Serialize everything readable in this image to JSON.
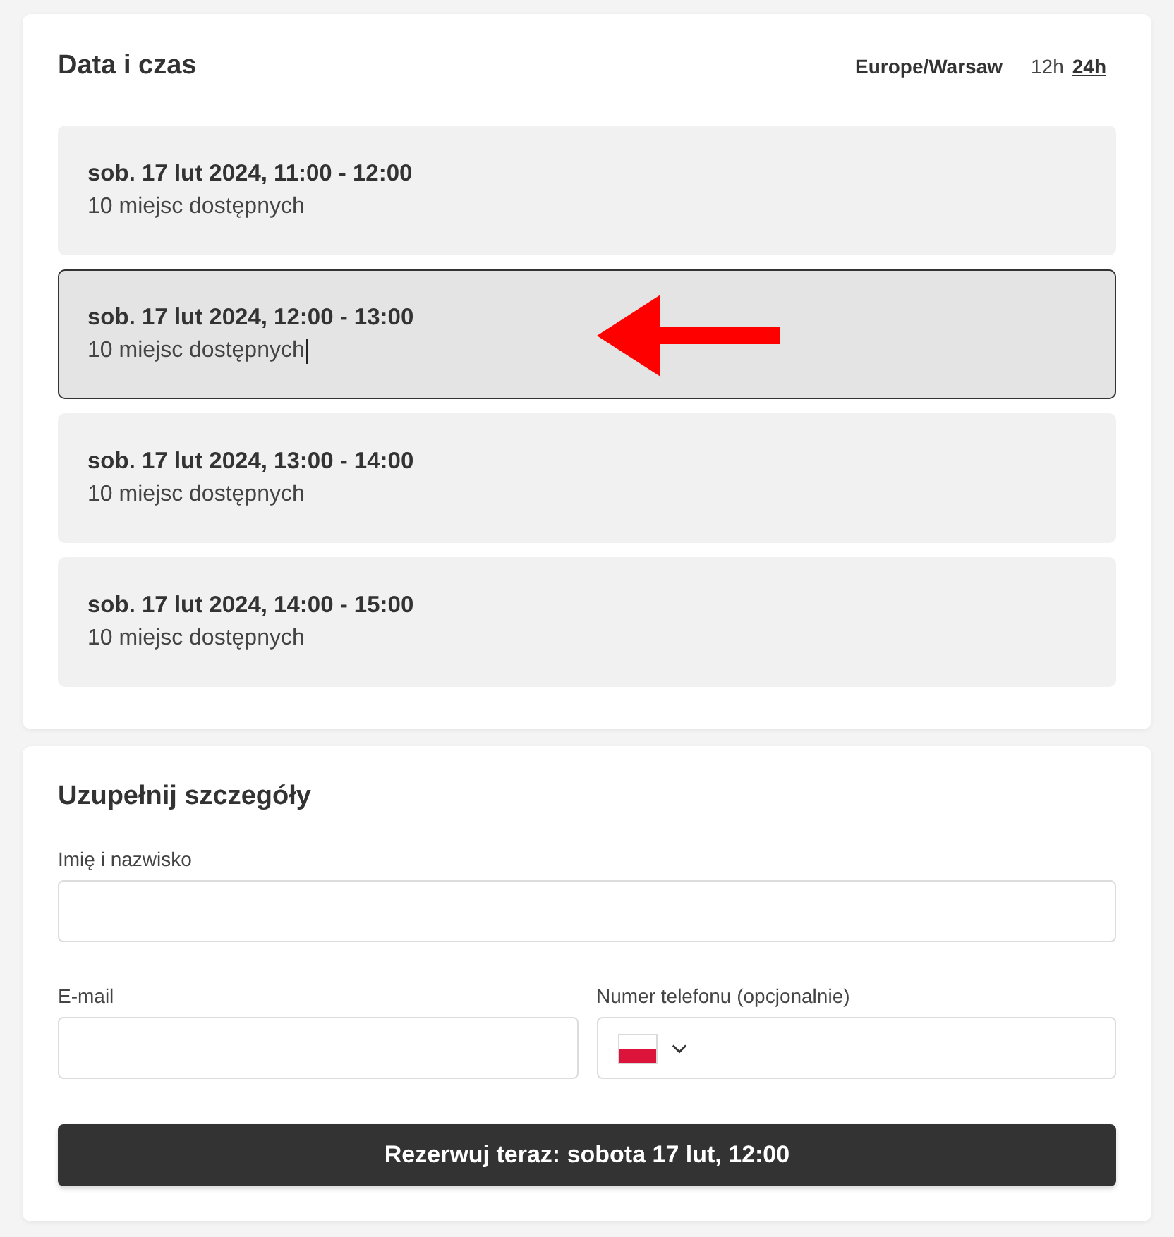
{
  "date_time": {
    "title": "Data i czas",
    "timezone": "Europe/Warsaw",
    "formats": [
      {
        "label": "12h",
        "selected": false
      },
      {
        "label": "24h",
        "selected": true
      }
    ],
    "slots": [
      {
        "time": "sob. 17 lut 2024, 11:00 - 12:00",
        "availability": "10 miejsc dostępnych",
        "selected": false,
        "text_cursor": false,
        "annotated": false
      },
      {
        "time": "sob. 17 lut 2024, 12:00 - 13:00",
        "availability": "10 miejsc dostępnych",
        "selected": true,
        "text_cursor": true,
        "annotated": true
      },
      {
        "time": "sob. 17 lut 2024, 13:00 - 14:00",
        "availability": "10 miejsc dostępnych",
        "selected": false,
        "text_cursor": false,
        "annotated": false
      },
      {
        "time": "sob. 17 lut 2024, 14:00 - 15:00",
        "availability": "10 miejsc dostępnych",
        "selected": false,
        "text_cursor": false,
        "annotated": false
      }
    ]
  },
  "details": {
    "title": "Uzupełnij szczegóły",
    "field_rows": [
      [
        {
          "kind": "text",
          "label": "Imię i nazwisko"
        }
      ],
      [
        {
          "kind": "text",
          "label": "E-mail"
        },
        {
          "kind": "phone",
          "label": "Numer telefonu (opcjonalnie)"
        }
      ]
    ],
    "submit": "Rezerwuj teraz: sobota 17 lut, 12:00"
  }
}
